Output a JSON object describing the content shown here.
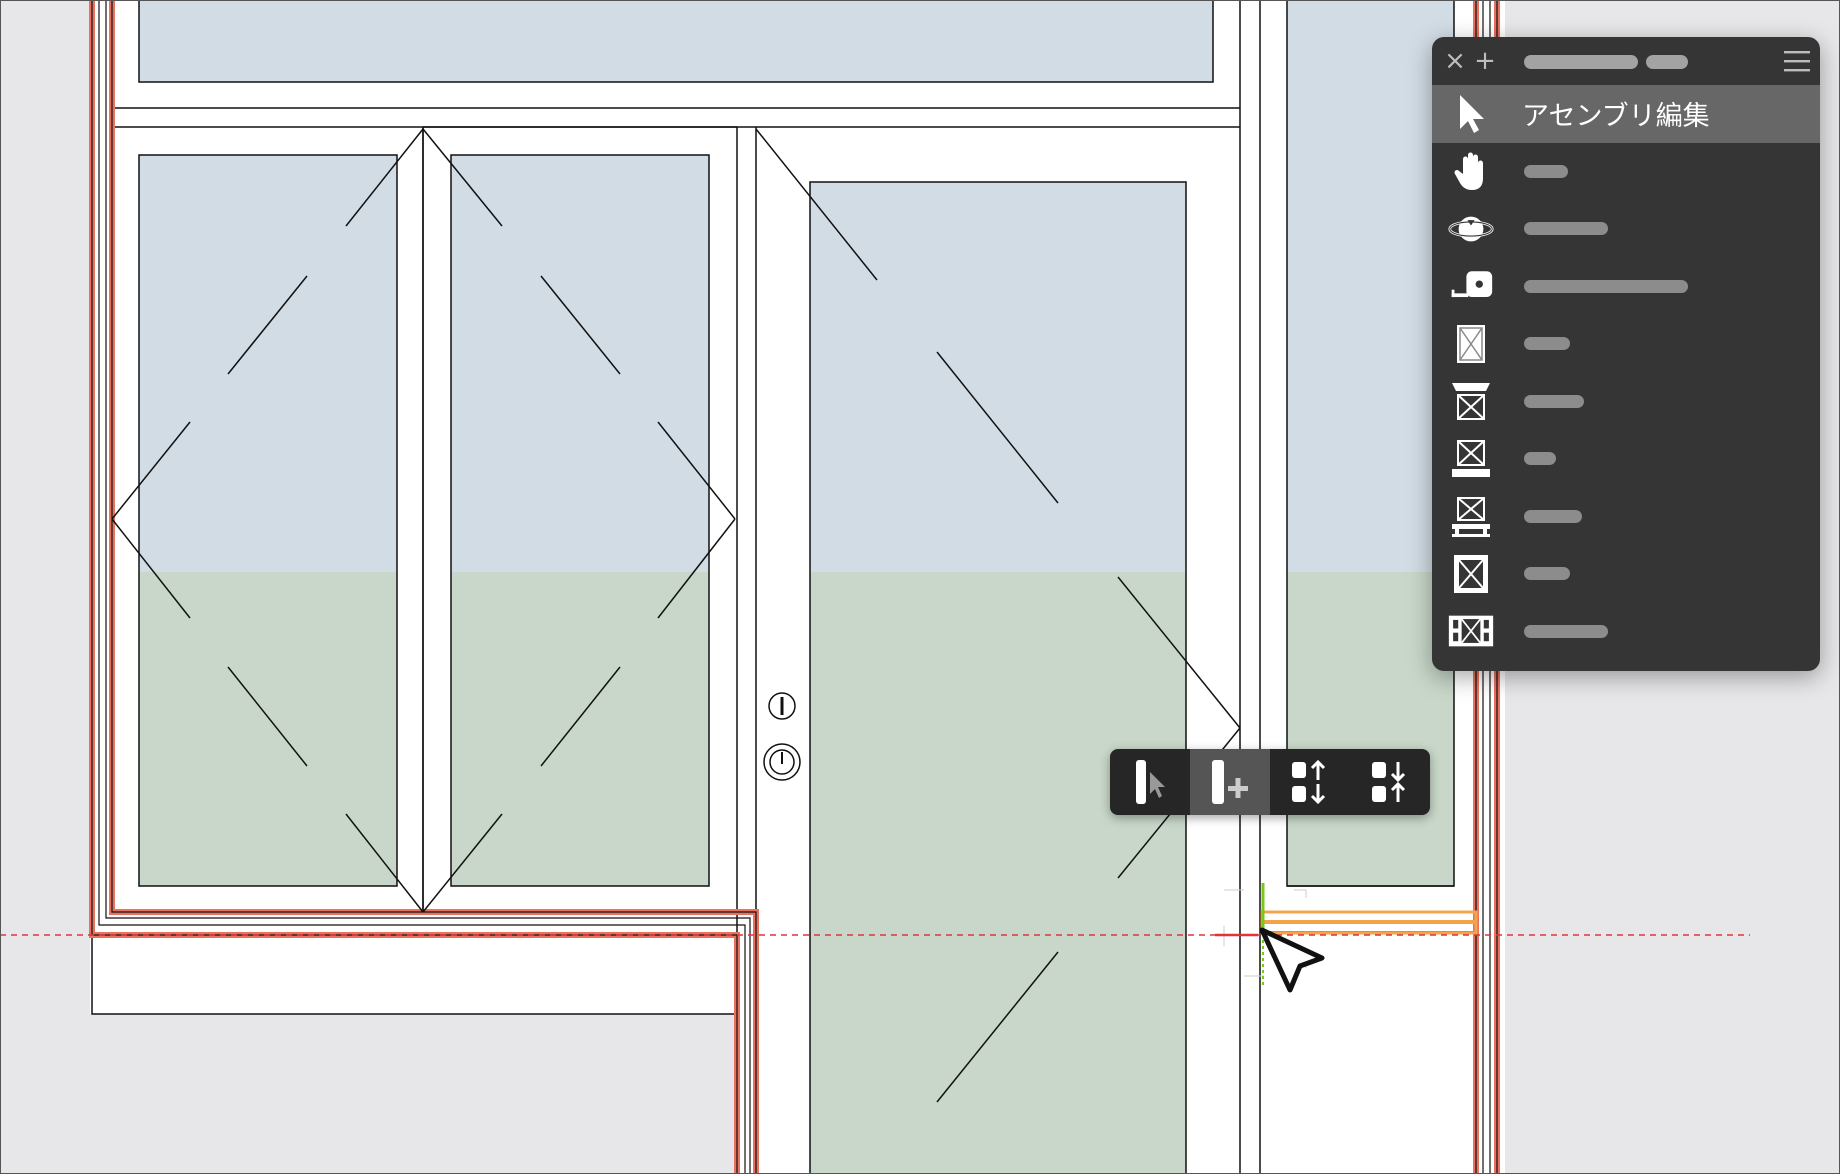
{
  "tool_palette": {
    "selected_label": "アセンブリ編集",
    "items": [
      {
        "icon": "select-arrow-icon",
        "selected": true
      },
      {
        "icon": "pan-hand-icon"
      },
      {
        "icon": "orbit-icon"
      },
      {
        "icon": "tape-measure-icon"
      },
      {
        "icon": "panel-x-icon"
      },
      {
        "icon": "head-frame-icon"
      },
      {
        "icon": "sill-frame-icon"
      },
      {
        "icon": "sill-stand-icon"
      },
      {
        "icon": "framed-panel-icon"
      },
      {
        "icon": "sidelight-panel-icon"
      }
    ],
    "header_icons": [
      "close-icon",
      "add-icon",
      "hamburger-menu-icon"
    ]
  },
  "context_popup": {
    "buttons": [
      {
        "icon": "select-member-icon",
        "active": false
      },
      {
        "icon": "add-member-icon",
        "active": true
      },
      {
        "icon": "swap-up-down-icon",
        "active": false
      },
      {
        "icon": "swap-down-up-icon",
        "active": false
      }
    ]
  },
  "colors": {
    "glass_sky": "#d2dce4",
    "glass_ground": "#c8d7c9",
    "wall_highlight": "#e8725f",
    "guide_line": "#e0343a",
    "snap_point": "#79c71b",
    "hover_member": "#f3a44b",
    "panel_bg": "#353535",
    "panel_selected": "#676767"
  }
}
